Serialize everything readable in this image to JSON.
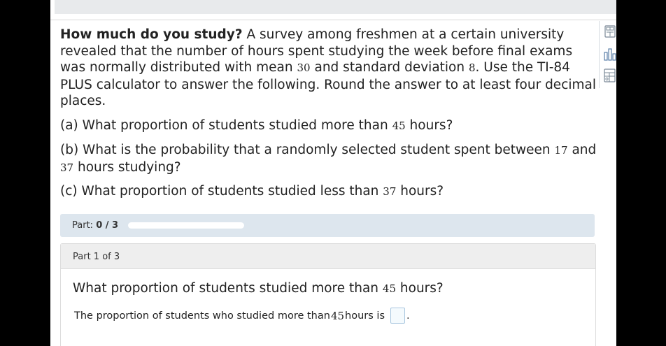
{
  "problem": {
    "title": "How much do you study?",
    "text_1": " A survey among freshmen at a certain university revealed that the number of hours spent studying the week before final exams was normally distributed with mean ",
    "mean": "30",
    "text_2": " and standard deviation ",
    "sd": "8",
    "text_3": ". Use the TI-84 PLUS calculator to answer the following. Round the answer to at least four decimal places."
  },
  "questions": {
    "a_pre": "(a) What proportion of students studied more than ",
    "a_num": "45",
    "a_post": " hours?",
    "b_pre": "(b) What is the probability that a randomly selected student spent between ",
    "b_num1": "17",
    "b_mid": " and ",
    "b_num2": "37",
    "b_post": " hours studying?",
    "c_pre": "(c) What proportion of students studied less than ",
    "c_num": "37",
    "c_post": " hours?"
  },
  "progress": {
    "label": "Part: ",
    "value": "0 / 3",
    "fraction": 0
  },
  "part": {
    "title": "Part 1 of 3",
    "question_pre": "What proportion of students studied more than ",
    "question_num": "45",
    "question_post": " hours?",
    "answer_pre": "The proportion of students who studied more than ",
    "answer_num": "45",
    "answer_post": " hours is",
    "answer_value": "",
    "period": "."
  },
  "tools": [
    "calculator-icon",
    "chart-icon",
    "data-table-icon"
  ],
  "colors": {
    "progress_bg": "#dde6ee",
    "progress_fill": "#3f7fbf",
    "input_border": "#a9c7df"
  }
}
